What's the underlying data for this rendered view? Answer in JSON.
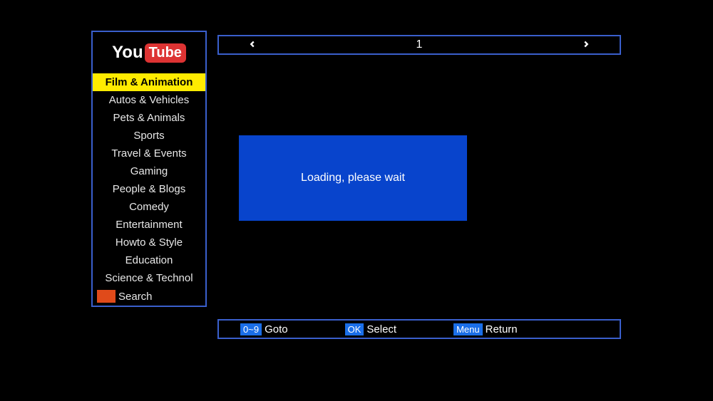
{
  "logo": {
    "you": "You",
    "tube": "Tube"
  },
  "sidebar": {
    "items": [
      {
        "label": "Film & Animation",
        "selected": true
      },
      {
        "label": "Autos & Vehicles",
        "selected": false
      },
      {
        "label": "Pets & Animals",
        "selected": false
      },
      {
        "label": "Sports",
        "selected": false
      },
      {
        "label": "Travel & Events",
        "selected": false
      },
      {
        "label": "Gaming",
        "selected": false
      },
      {
        "label": "People & Blogs",
        "selected": false
      },
      {
        "label": "Comedy",
        "selected": false
      },
      {
        "label": "Entertainment",
        "selected": false
      },
      {
        "label": "Howto & Style",
        "selected": false
      },
      {
        "label": "Education",
        "selected": false
      },
      {
        "label": "Science & Technol",
        "selected": false
      }
    ],
    "search_label": "Search"
  },
  "pagination": {
    "current_page": "1"
  },
  "loading": {
    "message": "Loading, please wait"
  },
  "footer": {
    "goto": {
      "key": "0~9",
      "label": "Goto"
    },
    "select": {
      "key": "OK",
      "label": "Select"
    },
    "return": {
      "key": "Menu",
      "label": "Return"
    }
  }
}
